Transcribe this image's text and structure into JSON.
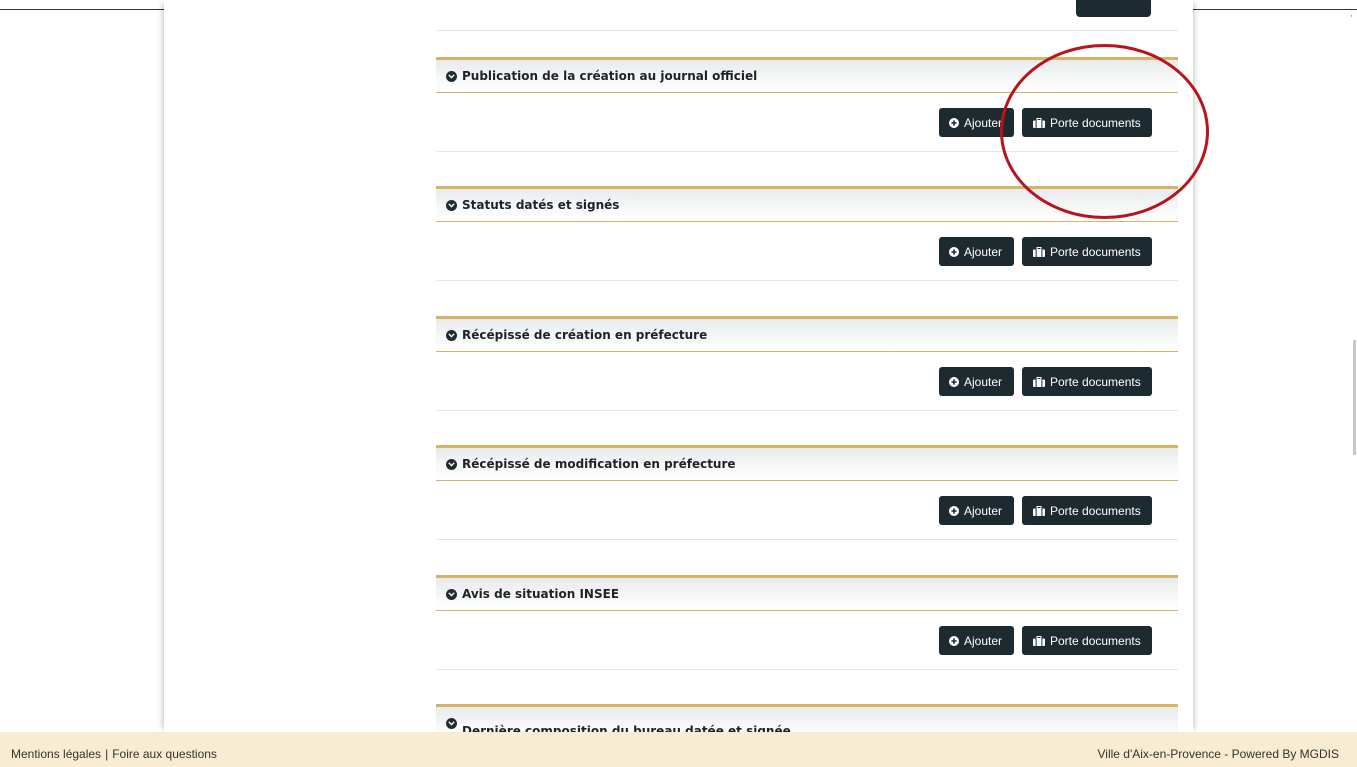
{
  "colors": {
    "accent_gold": "#d4b465",
    "button_bg": "#1d2b30",
    "annotation_red": "#b8141b",
    "footer_bg": "#f8ecd2"
  },
  "sections": [
    {
      "title": "Publication de la création au journal officiel",
      "add_label": "Ajouter",
      "docs_label": "Porte documents"
    },
    {
      "title": "Statuts datés et signés",
      "add_label": "Ajouter",
      "docs_label": "Porte documents"
    },
    {
      "title": "Récépissé de création en préfecture",
      "add_label": "Ajouter",
      "docs_label": "Porte documents"
    },
    {
      "title": "Récépissé de modification en préfecture",
      "add_label": "Ajouter",
      "docs_label": "Porte documents"
    },
    {
      "title": "Avis de situation INSEE",
      "add_label": "Ajouter",
      "docs_label": "Porte documents"
    },
    {
      "title": "Dernière composition du bureau datée et signée"
    }
  ],
  "icons": {
    "section_toggle": "chevron-circle-down-icon",
    "add": "plus-circle-icon",
    "docs": "briefcase-icon"
  },
  "footer": {
    "legal_link": "Mentions légales",
    "separator": "|",
    "faq_link": "Foire aux questions",
    "credit": "Ville d'Aix-en-Provence - Powered By MGDIS"
  }
}
